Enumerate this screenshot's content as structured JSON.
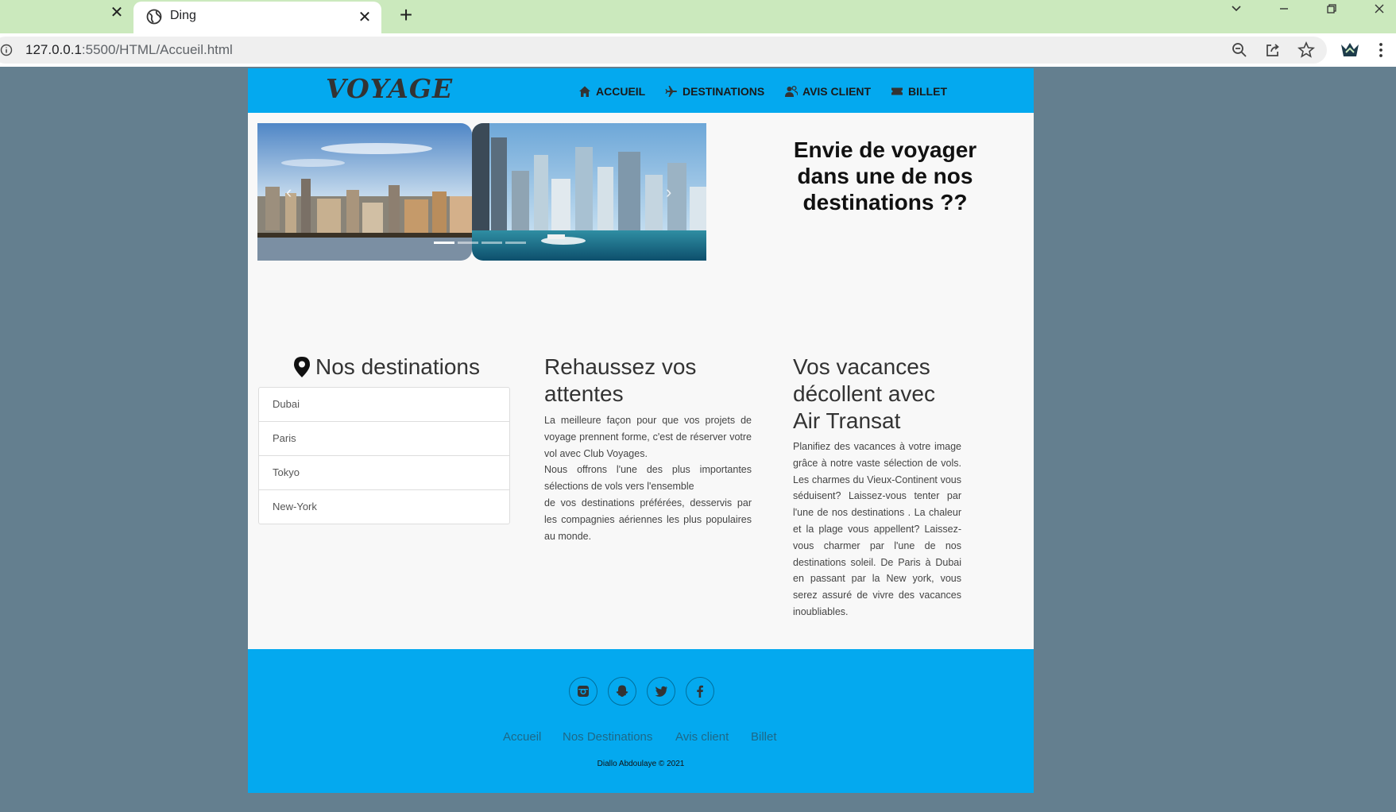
{
  "browser": {
    "tab_active_title": "Ding",
    "tab_close_glyph": "✕",
    "new_tab_glyph": "+",
    "url_host": "127.0.0.1",
    "url_path": ":5500/HTML/Accueil.html"
  },
  "navbar": {
    "brand": "VOYAGE",
    "items": [
      {
        "label": "ACCUEIL",
        "icon": "home-icon"
      },
      {
        "label": "DESTINATIONS",
        "icon": "plane-icon"
      },
      {
        "label": "AVIS CLIENT",
        "icon": "users-icon"
      },
      {
        "label": "BILLET",
        "icon": "ticket-icon"
      }
    ]
  },
  "hero": {
    "title": "Envie de voyager dans une de nos destinations ??",
    "carousel_prev": "‹",
    "carousel_next": "›"
  },
  "destinations": {
    "title": "Nos destinations",
    "items": [
      "Dubai",
      "Paris",
      "Tokyo",
      "New-York"
    ]
  },
  "expectations": {
    "title": "Rehaussez vos attentes",
    "paragraph1": "La meilleure façon pour que vos projets de voyage prennent forme, c'est de réserver votre vol avec Club Voyages.",
    "paragraph2": "Nous offrons l'une des plus importantes sélections de vols vers l'ensemble",
    "paragraph3": "de vos destinations préférées, desservis par les compagnies aériennes les plus populaires au monde."
  },
  "vacation": {
    "title": "Vos vacances décollent avec Air Transat",
    "text": "Planifiez des vacances à votre image grâce à notre vaste sélection de vols. Les charmes du Vieux-Continent vous séduisent? Laissez-vous tenter par l'une de nos destinations . La chaleur et la plage vous appellent? Laissez-vous charmer par l'une de nos destinations soleil. De Paris à Dubai en passant par la New york, vous serez assuré de vivre des vacances inoubliables."
  },
  "footer": {
    "social": [
      "instagram-icon",
      "snapchat-icon",
      "twitter-icon",
      "facebook-icon"
    ],
    "links": [
      "Accueil",
      "Nos Destinations",
      "Avis client",
      "Billet"
    ],
    "copyright": "Diallo Abdoulaye © 2021"
  },
  "colors": {
    "accent": "#04a9ef",
    "background": "#647f8f",
    "content": "#f8f8f8",
    "tabbar": "#cbe9bd"
  }
}
